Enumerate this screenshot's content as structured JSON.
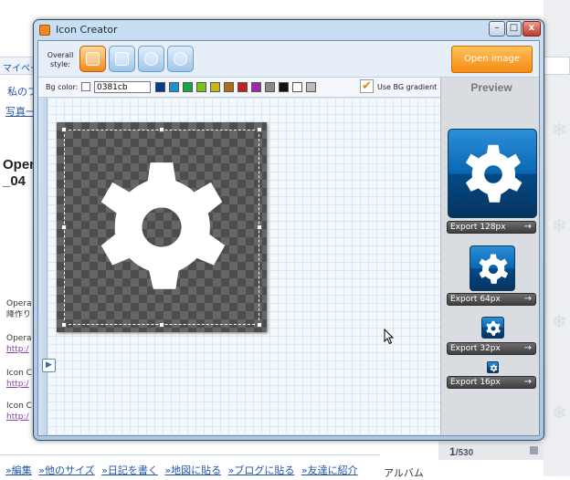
{
  "background_page": {
    "nav_text": "マイページ",
    "tab_text": "私のフ",
    "photo_link": "写真一",
    "title": "Opera_04",
    "title_lines": [
      "Opera",
      "_04"
    ],
    "snippet1": [
      "Opera",
      "降作り"
    ],
    "link_http": "http:/",
    "snippet2": "Opera",
    "snippet3": "Icon C",
    "snippet4": "Icon C",
    "bottom_links": [
      "»編集",
      "»他のサイズ",
      "»日記を書く",
      "»地図に貼る",
      "»ブログに貼る",
      "»友達に紹介"
    ],
    "album_label": "アルバム",
    "pager_text": "/530",
    "pager_current": "1"
  },
  "window": {
    "title": "Icon Creator",
    "minimize": "–",
    "maximize": "□",
    "close": "x"
  },
  "toolbar": {
    "overall_style_label": "Overall style:",
    "open_image_label": "Open image"
  },
  "colorbar": {
    "bg_color_label": "Bg color:",
    "hex_value": "0381cb",
    "swatches": [
      "#0a3c8c",
      "#1f8fd0",
      "#1aa44a",
      "#7bbf22",
      "#c9b61a",
      "#b06b14",
      "#c02020",
      "#9b2aa6",
      "#888888",
      "#111111",
      "#ffffff",
      "#bbbbbb"
    ],
    "use_gradient_label": "Use BG gradient",
    "use_gradient_checked": true
  },
  "preview": {
    "header": "Preview",
    "exports": [
      {
        "label": "Export 128px",
        "arrow": "→"
      },
      {
        "label": "Export 64px",
        "arrow": "→"
      },
      {
        "label": "Export 32px",
        "arrow": "→"
      },
      {
        "label": "Export 16px",
        "arrow": "→"
      }
    ]
  },
  "canvas": {
    "play_icon": "▶"
  },
  "colors": {
    "accent_orange": "#f58a10",
    "icon_blue": "#0381cb"
  }
}
